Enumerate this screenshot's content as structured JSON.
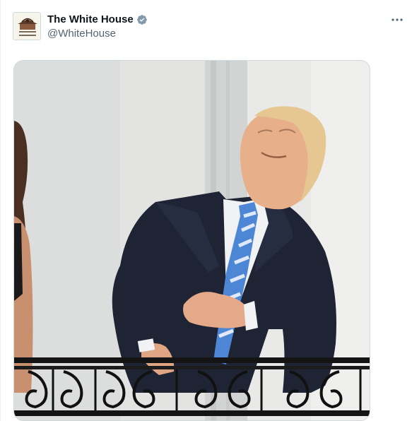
{
  "tweet": {
    "author": {
      "display_name": "The White House",
      "handle": "@WhiteHouse",
      "verified": true,
      "verified_color": "#829aab",
      "avatar_icon": "white-house-logo-icon"
    },
    "more_icon": "more-options-icon",
    "media": {
      "type": "photo",
      "subject": "man-looking-up-on-balcony"
    }
  }
}
